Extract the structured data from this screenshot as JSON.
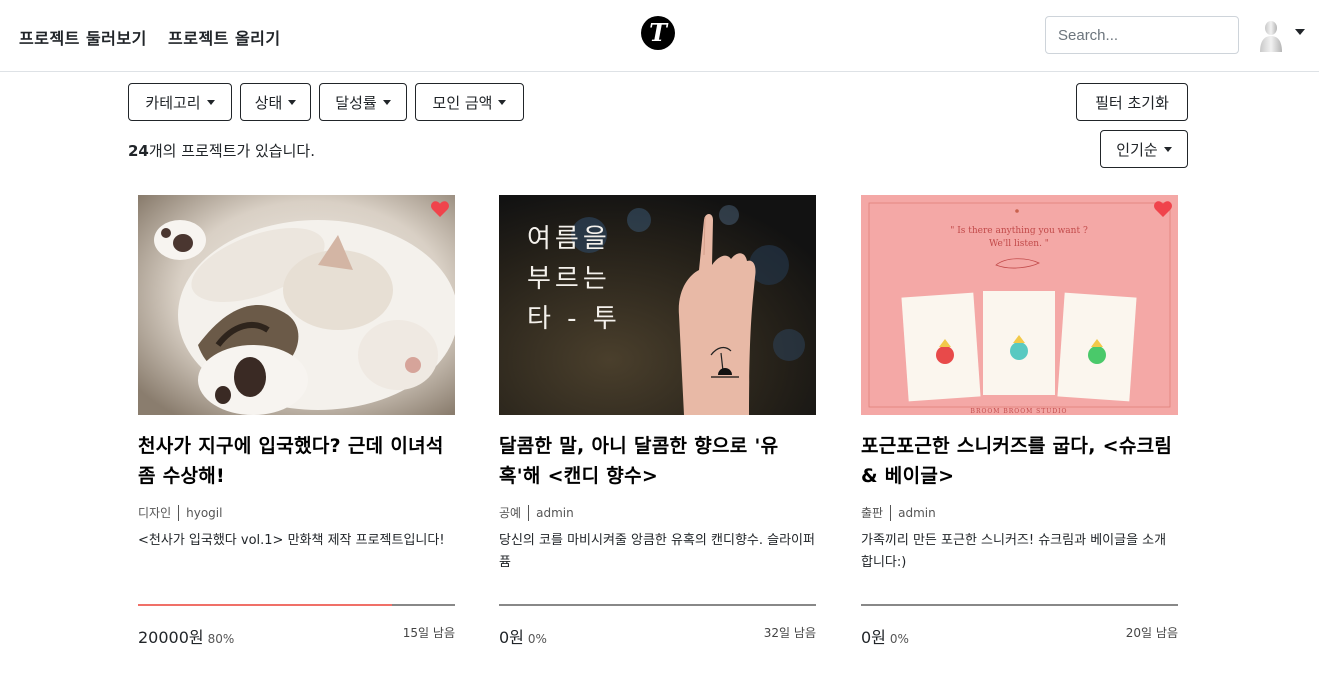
{
  "nav": {
    "browse": "프로젝트 둘러보기",
    "upload": "프로젝트 올리기",
    "logo_letter": "T",
    "search_placeholder": "Search..."
  },
  "filters": {
    "category": "카테고리",
    "status": "상태",
    "rate": "달성률",
    "amount": "모인 금액",
    "reset": "필터 초기화",
    "sort": "인기순"
  },
  "summary": {
    "count": "24",
    "suffix": "개의 프로젝트가 있습니다."
  },
  "colors": {
    "heart": "#f0444c",
    "progress": "#f07068",
    "track": "#888888"
  },
  "cards": [
    {
      "title": "천사가 지구에 입국했다? 근데 이녀석 좀 수상해!",
      "category": "디자인",
      "author": "hyogil",
      "desc": "<천사가 입국했다 vol.1> 만화책 제작 프로젝트입니다!",
      "amount": "20000원",
      "percent": "80%",
      "progress": 0.8,
      "days": "15일 남음",
      "image": "kitten-photo",
      "heart": true
    },
    {
      "title": "달콤한 말, 아니 달콤한 향으로 '유혹'해 <캔디 향수>",
      "category": "공예",
      "author": "admin",
      "desc": "당신의 코를 마비시켜줄 앙큼한 유혹의 캔디향수. 슬라이퍼퓸",
      "amount": "0원",
      "percent": "0%",
      "progress": 0,
      "days": "32일 남음",
      "image": "tattoo-photo",
      "image_text": [
        "여름을",
        "부르는",
        "타 - 투"
      ],
      "heart": false
    },
    {
      "title": "포근포근한 스니커즈를 굽다, <슈크림 & 베이글>",
      "category": "출판",
      "author": "admin",
      "desc": "가족끼리 만든 포근한 스니커즈! 슈크림과 베이글을 소개합니다:)",
      "amount": "0원",
      "percent": "0%",
      "progress": 0,
      "days": "20일 남음",
      "image": "pink-cards-illustration",
      "image_text": [
        "\" Is there anything you want ?",
        "We'll listen. \"",
        "BROOM BROOM STUDIO"
      ],
      "heart": true
    }
  ]
}
